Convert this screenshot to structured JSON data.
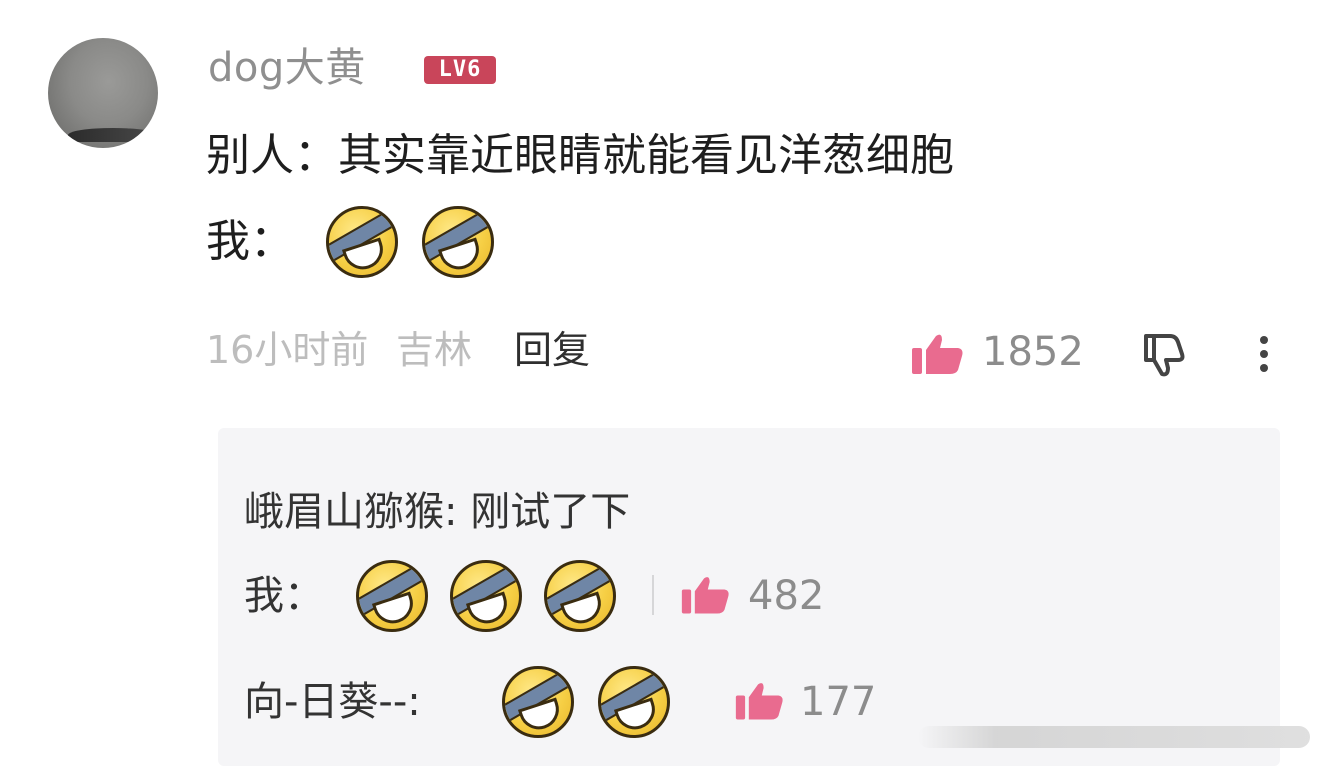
{
  "comment": {
    "username": "dog大黄",
    "level": "LV6",
    "lines": [
      "别人：其实靠近眼睛就能看见洋葱细胞",
      "我："
    ],
    "time": "16小时前",
    "location": "吉林",
    "reply_label": "回复",
    "likes": "1852"
  },
  "replies": [
    {
      "text": "峨眉山猕猴: 刚试了下"
    },
    {
      "text": "我：",
      "likes": "482"
    },
    {
      "text": "向-日葵--:",
      "likes": "177"
    }
  ],
  "icons": [
    "thumbs-up-icon",
    "thumbs-down-icon",
    "more-vertical-icon",
    "laugh-emoji-icon"
  ],
  "colors": {
    "accent": "#e96b8f",
    "badge": "#c9455a",
    "reply_bg": "#f5f5f7"
  }
}
